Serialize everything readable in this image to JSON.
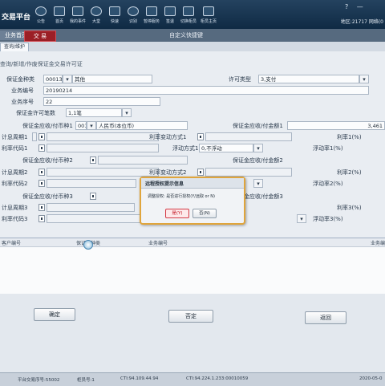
{
  "app": {
    "title": "交易平台"
  },
  "toolbar": {
    "buttons": [
      {
        "label": "公告"
      },
      {
        "label": "首页"
      },
      {
        "label": "我的事件"
      },
      {
        "label": "大堂"
      },
      {
        "label": "快速"
      },
      {
        "label": "识别"
      },
      {
        "label": "暂停服务"
      },
      {
        "label": "签退"
      },
      {
        "label": "切换柜员"
      },
      {
        "label": "柜员主页"
      }
    ],
    "right_region": "地区:21717",
    "right_user": "网络(0",
    "help_icon": "?"
  },
  "tabs": {
    "home": "业务首页",
    "trade": "交 易",
    "shortcut": "自定义快捷键"
  },
  "subtab": "查询/维护",
  "form": {
    "title": "查询/新增/作废保证金交易许可证",
    "deposit_type_label": "保证金种类",
    "deposit_type_code": "00013",
    "deposit_type_name": "其他",
    "permit_type_label": "许可类型",
    "permit_type_value": "3,支付",
    "business_no_label": "业务编号",
    "business_no_value": "20190214",
    "business_seq_label": "业务序号",
    "business_seq_value": "22",
    "permit_count_label": "保证金许可笔数",
    "permit_count_value": "1,1笔",
    "currency1_label": "保证金应收/付币种1",
    "currency1_code": "001",
    "currency1_name": "人民币(本位币)",
    "amount1_label": "保证金应收/付金额1",
    "amount1_value": "3,461",
    "period1_label": "计息周期1",
    "rate_change1_label": "利率变动方式1",
    "rate1_label": "利率1(%)",
    "rate_code1_label": "利率代码1",
    "float_mode1_label": "浮动方式1",
    "float_mode1_value": "0,不浮动",
    "float_rate1_label": "浮动率1(%)",
    "currency2_label": "保证金应收/付币种2",
    "amount2_label": "保证金应收/付金额2",
    "period2_label": "计息周期2",
    "rate_change2_label": "利率变动方式2",
    "rate2_label": "利率2(%)",
    "rate_code2_label": "利率代码2",
    "float_rate2_label": "浮动率2(%)",
    "currency3_label": "保证金应收/付币种3",
    "amount3_label": "保证金应收/付金额3",
    "period3_label": "计息周期3",
    "rate3_label": "利率3(%)",
    "rate_code3_label": "利率代码3",
    "float_rate3_label": "浮动率3(%)"
  },
  "grid": {
    "headers": [
      "客户编号",
      "保证金种类",
      "业务编号",
      "业务编"
    ]
  },
  "buttons": {
    "ok": "确定",
    "deny": "否定",
    "back": "返回"
  },
  "dialog": {
    "title": "远程授权提示信息",
    "message": "调整授权: 是否进行授权(Y/远取 or N)",
    "yes": "是(Y)",
    "no": "否(N)"
  },
  "statusbar": {
    "platform": "平台交易序号:55002",
    "teller": "柜员号:1",
    "cti1": "CTI:94.109.44.94",
    "cti2": "CTI:94.224.1.233:00010059",
    "date": "2020-05-0"
  },
  "colors": {
    "accent_red": "#9b1f26",
    "dialog_border": "#e0a53c",
    "topbar": "#0f2a44"
  }
}
